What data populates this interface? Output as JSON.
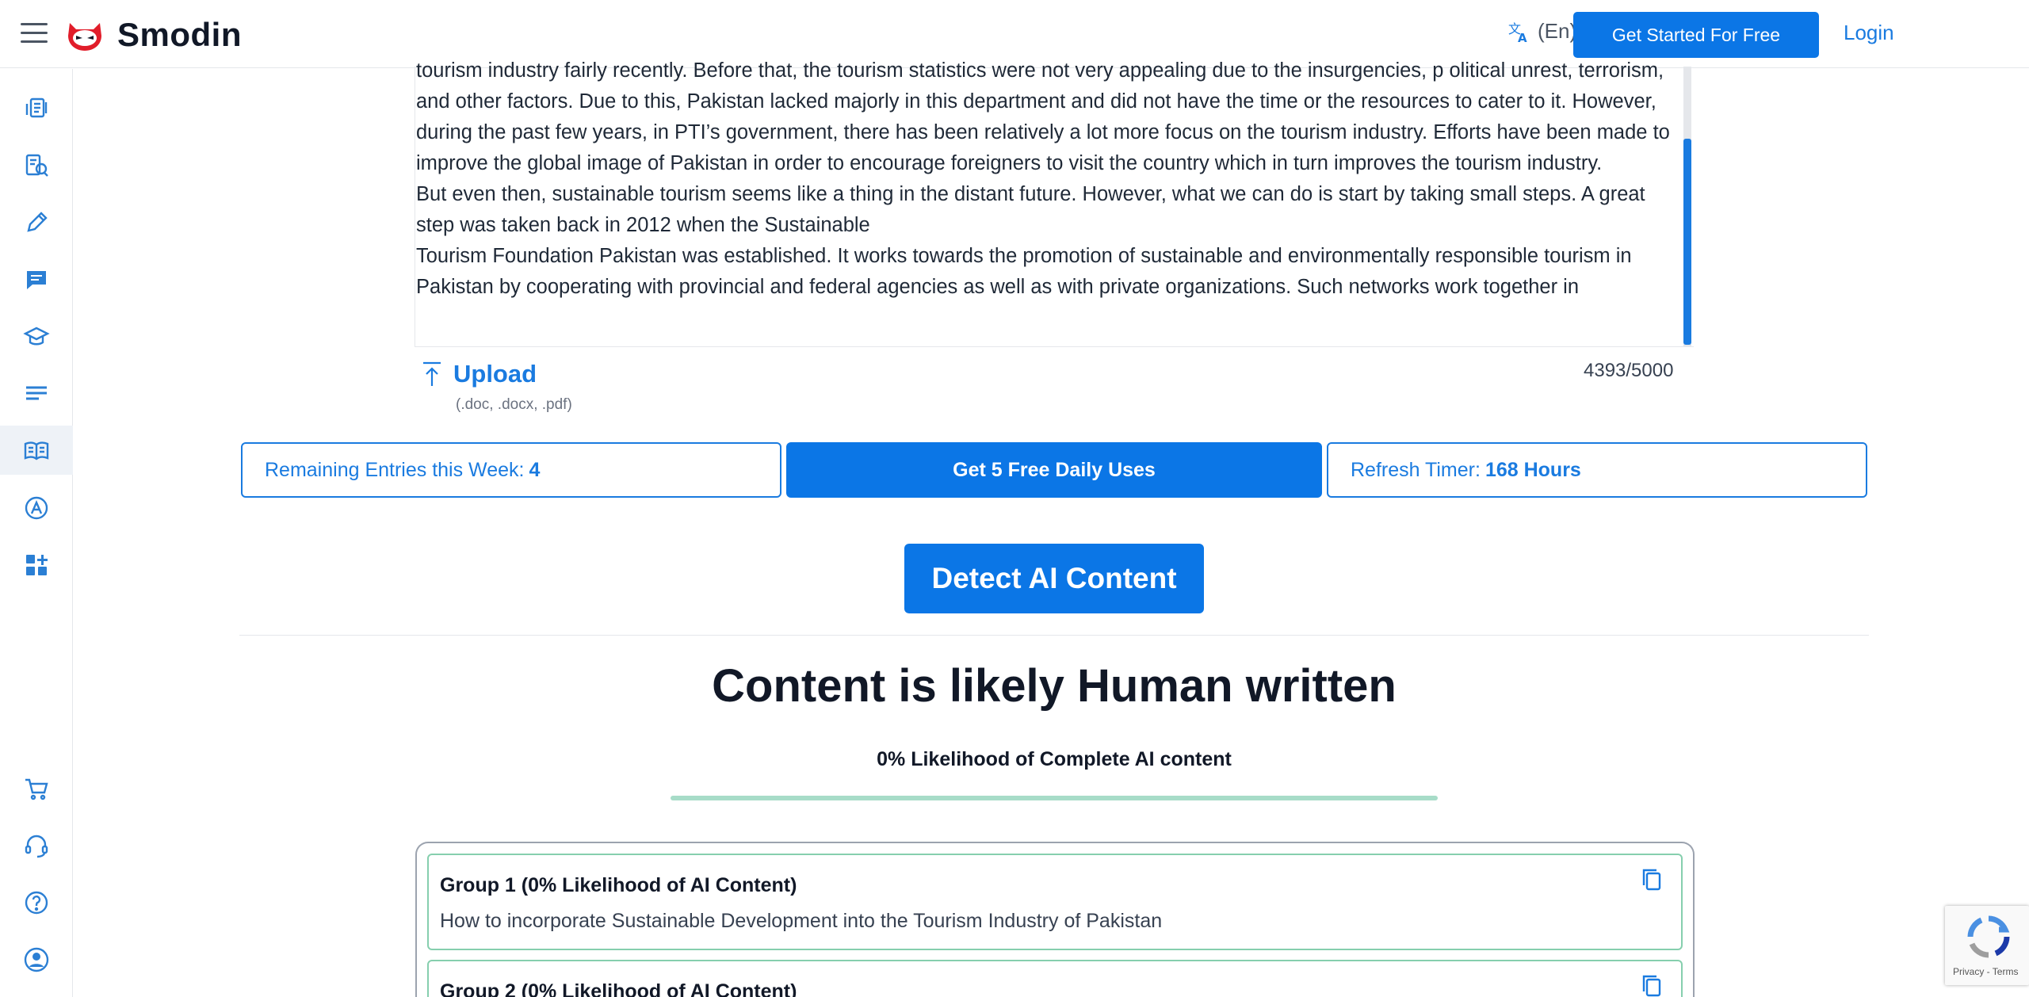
{
  "header": {
    "brand": "Smodin",
    "language": "(En)",
    "get_started": "Get Started For Free",
    "login": "Login"
  },
  "sidebar": {
    "items": [
      {
        "icon": "paraphrase-icon"
      },
      {
        "icon": "search-document-icon"
      },
      {
        "icon": "pencil-icon"
      },
      {
        "icon": "chat-icon"
      },
      {
        "icon": "graduation-cap-icon"
      },
      {
        "icon": "text-lines-icon"
      },
      {
        "icon": "open-book-icon",
        "active": true
      },
      {
        "icon": "ai-grader-icon"
      },
      {
        "icon": "apps-plus-icon"
      }
    ],
    "bottom": [
      {
        "icon": "cart-icon"
      },
      {
        "icon": "headset-icon"
      },
      {
        "icon": "help-icon"
      },
      {
        "icon": "user-icon"
      }
    ]
  },
  "editor": {
    "paragraphs": [
      "tourism industry fairly recently. Before that, the tourism  statistics  were  not  very  appealing  due  to  the  insurgencies,  p olitical  unrest, terrorism,   and  other  factors. Due to this, Pakistan lacked majorly in this department and did not have the time or   the   resources to cater to it. However, during the past few years, in PTI’s government, there has  been  relatively a lot more focus on the tourism industry. Efforts have been made to improve the  global  image of Pakistan in order to encourage  foreigners    to visit the country which in turn improves the tourism industry.",
      "But even then, sustainable tourism seems like a thing in the distant future. However, what  we can do is start by taking small steps.  A great step was taken back in 2012 when the Sustainable",
      "Tourism Foundation Pakistan was established. It works towards the promotion of sustainable and  environmentally  responsible  tourism in  Pakistan   by  cooperating  with  provincial  and  federal  agencies as well as with private organizations. Such networks work together in"
    ],
    "upload_label": "Upload",
    "upload_formats": "(.doc, .docx, .pdf)",
    "char_count": "4393/5000"
  },
  "usage": {
    "remaining_label": "Remaining Entries this Week:",
    "remaining_value": "4",
    "daily_button": "Get 5 Free Daily Uses",
    "refresh_label": "Refresh Timer:",
    "refresh_value": "168 Hours"
  },
  "detect_button": "Detect AI Content",
  "result": {
    "title": "Content is likely Human written",
    "likelihood": "0% Likelihood of Complete AI content",
    "progress_fraction": 1.0,
    "progress_color": "#a7dcc8"
  },
  "groups": [
    {
      "title": "Group 1 (0% Likelihood of AI Content)",
      "text": "How to incorporate Sustainable Development into the Tourism Industry of Pakistan"
    },
    {
      "title": "Group 2 (0% Likelihood of AI Content)",
      "text": ""
    }
  ],
  "recaptcha": {
    "links": "Privacy - Terms"
  },
  "colors": {
    "accent": "#0b76e6",
    "link": "#1a7be0",
    "group_border": "#86cfae"
  }
}
